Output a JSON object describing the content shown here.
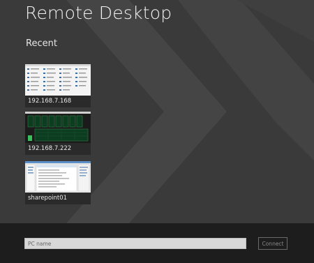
{
  "app": {
    "title": "Remote Desktop"
  },
  "recent": {
    "heading": "Recent",
    "items": [
      {
        "label": "192.168.7.168",
        "thumb": "desktop-icons"
      },
      {
        "label": "192.168.7.222",
        "thumb": "performance-monitor"
      },
      {
        "label": "sharepoint01",
        "thumb": "server-manager"
      }
    ]
  },
  "connect_bar": {
    "placeholder": "PC name",
    "value": "",
    "button_label": "Connect"
  },
  "colors": {
    "background": "#3a3a3a",
    "chevron": "#444444",
    "bottom_bar": "#1d1d1d",
    "input_bg": "#d8d8d8"
  }
}
